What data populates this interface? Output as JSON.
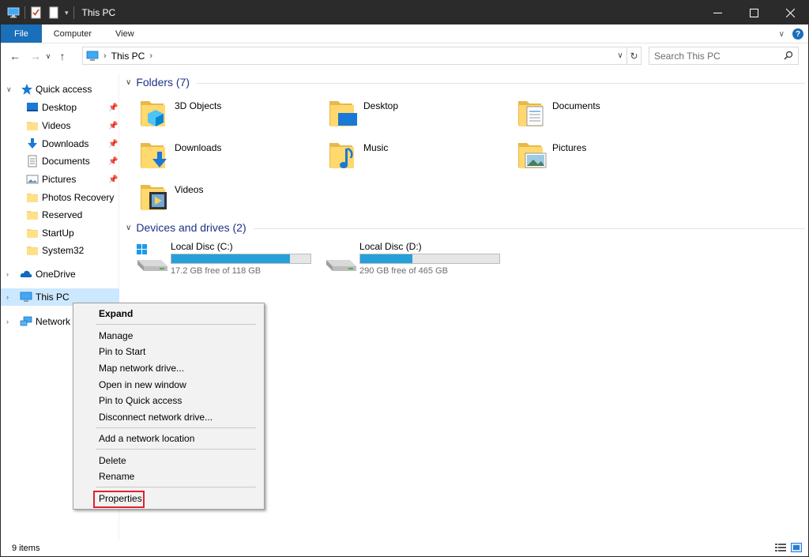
{
  "window": {
    "title": "This PC"
  },
  "ribbon": {
    "tabs": [
      "File",
      "Computer",
      "View"
    ]
  },
  "address": {
    "crumb": "This PC",
    "search_placeholder": "Search This PC"
  },
  "navpane": {
    "quick_access": "Quick access",
    "items": [
      {
        "label": "Desktop",
        "pinned": true
      },
      {
        "label": "Videos",
        "pinned": true
      },
      {
        "label": "Downloads",
        "pinned": true
      },
      {
        "label": "Documents",
        "pinned": true
      },
      {
        "label": "Pictures",
        "pinned": true
      },
      {
        "label": "Photos Recovery",
        "pinned": false
      },
      {
        "label": "Reserved",
        "pinned": false
      },
      {
        "label": "StartUp",
        "pinned": false
      },
      {
        "label": "System32",
        "pinned": false
      }
    ],
    "onedrive": "OneDrive",
    "this_pc": "This PC",
    "network": "Network"
  },
  "content": {
    "folders_header": "Folders (7)",
    "folders": [
      "3D Objects",
      "Desktop",
      "Documents",
      "Downloads",
      "Music",
      "Pictures",
      "Videos"
    ],
    "drives_header": "Devices and drives (2)",
    "drives": [
      {
        "name": "Local Disc (C:)",
        "free": "17.2 GB free of 118 GB",
        "used_fraction": 0.854
      },
      {
        "name": "Local Disc (D:)",
        "free": "290 GB free of 465 GB",
        "used_fraction": 0.376
      }
    ]
  },
  "context_menu": {
    "expand": "Expand",
    "group1": [
      "Manage",
      "Pin to Start",
      "Map network drive...",
      "Open in new window",
      "Pin to Quick access",
      "Disconnect network drive..."
    ],
    "group2": [
      "Add a network location"
    ],
    "group3": [
      "Delete",
      "Rename"
    ],
    "properties": "Properties"
  },
  "status": {
    "items": "9 items"
  },
  "colors": {
    "accent": "#1a6fb9",
    "selection": "#cce8ff",
    "drive_bar": "#26a0da",
    "highlight_box": "#e0222e",
    "group_header": "#1e3287"
  }
}
